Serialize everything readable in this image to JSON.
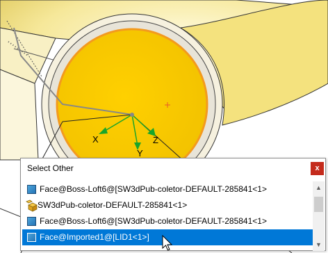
{
  "viewport": {
    "triad_labels": {
      "x": "X",
      "y": "Y",
      "z": "Z"
    }
  },
  "popup": {
    "title": "Select Other",
    "close_label": "x",
    "items": [
      {
        "label": "Face@Boss-Loft6@[SW3dPub-coletor-DEFAULT-285841<1>",
        "icon": "face-icon",
        "selected": false
      },
      {
        "label": "SW3dPub-coletor-DEFAULT-285841<1>",
        "icon": "part-icon",
        "selected": false
      },
      {
        "label": "Face@Boss-Loft6@[SW3dPub-coletor-DEFAULT-285841<1>",
        "icon": "face-icon",
        "selected": false
      },
      {
        "label": "Face@Imported1@[LID1<1>]",
        "icon": "face-icon",
        "selected": true
      }
    ]
  },
  "colors": {
    "selection": "#0078d7",
    "face_yellow": "#f7d000",
    "highlight_orange": "#f39a1e",
    "triad_green": "#1aa52a",
    "close_red": "#c42b1c"
  }
}
